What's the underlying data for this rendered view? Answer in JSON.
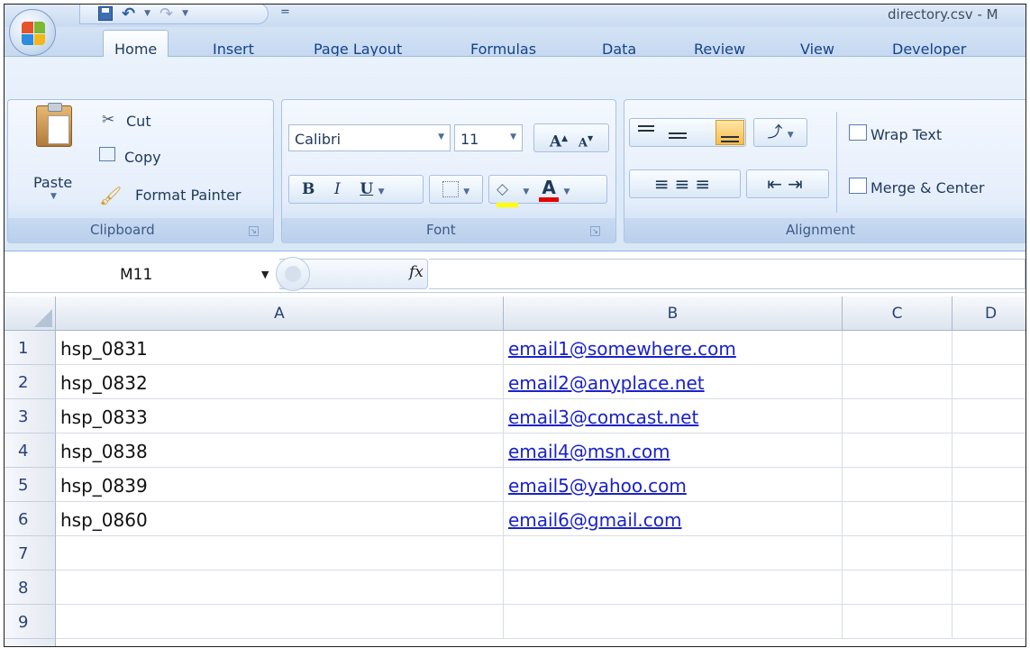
{
  "window": {
    "title": "directory.csv - M"
  },
  "qat": {
    "customize": "="
  },
  "tabs": {
    "home": "Home",
    "insert": "Insert",
    "page_layout": "Page Layout",
    "formulas": "Formulas",
    "data": "Data",
    "review": "Review",
    "view": "View",
    "developer": "Developer"
  },
  "clipboard": {
    "paste": "Paste",
    "cut": "Cut",
    "copy": "Copy",
    "format_painter": "Format Painter",
    "label": "Clipboard"
  },
  "font": {
    "name": "Calibri",
    "size": "11",
    "bold": "B",
    "italic": "I",
    "underline": "U",
    "grow": "A",
    "shrink": "A",
    "font_color": "A",
    "label": "Font"
  },
  "alignment": {
    "wrap_text": "Wrap Text",
    "merge_center": "Merge & Center",
    "label": "Alignment"
  },
  "formula_bar": {
    "name_box": "M11",
    "fx": "fx",
    "value": ""
  },
  "columns": [
    "A",
    "B",
    "C",
    "D"
  ],
  "rows": [
    {
      "num": "1",
      "a": "hsp_0831",
      "b": "email1@somewhere.com"
    },
    {
      "num": "2",
      "a": "hsp_0832",
      "b": "email2@anyplace.net"
    },
    {
      "num": "3",
      "a": "hsp_0833",
      "b": "email3@comcast.net"
    },
    {
      "num": "4",
      "a": "hsp_0838",
      "b": "email4@msn.com"
    },
    {
      "num": "5",
      "a": "hsp_0839",
      "b": "email5@yahoo.com"
    },
    {
      "num": "6",
      "a": "hsp_0860",
      "b": "email6@gmail.com"
    },
    {
      "num": "7",
      "a": "",
      "b": ""
    },
    {
      "num": "8",
      "a": "",
      "b": ""
    },
    {
      "num": "9",
      "a": "",
      "b": ""
    }
  ],
  "colors": {
    "accent": "#15428b",
    "link": "#1a22c8",
    "ribbon": "#dbe7f6"
  }
}
